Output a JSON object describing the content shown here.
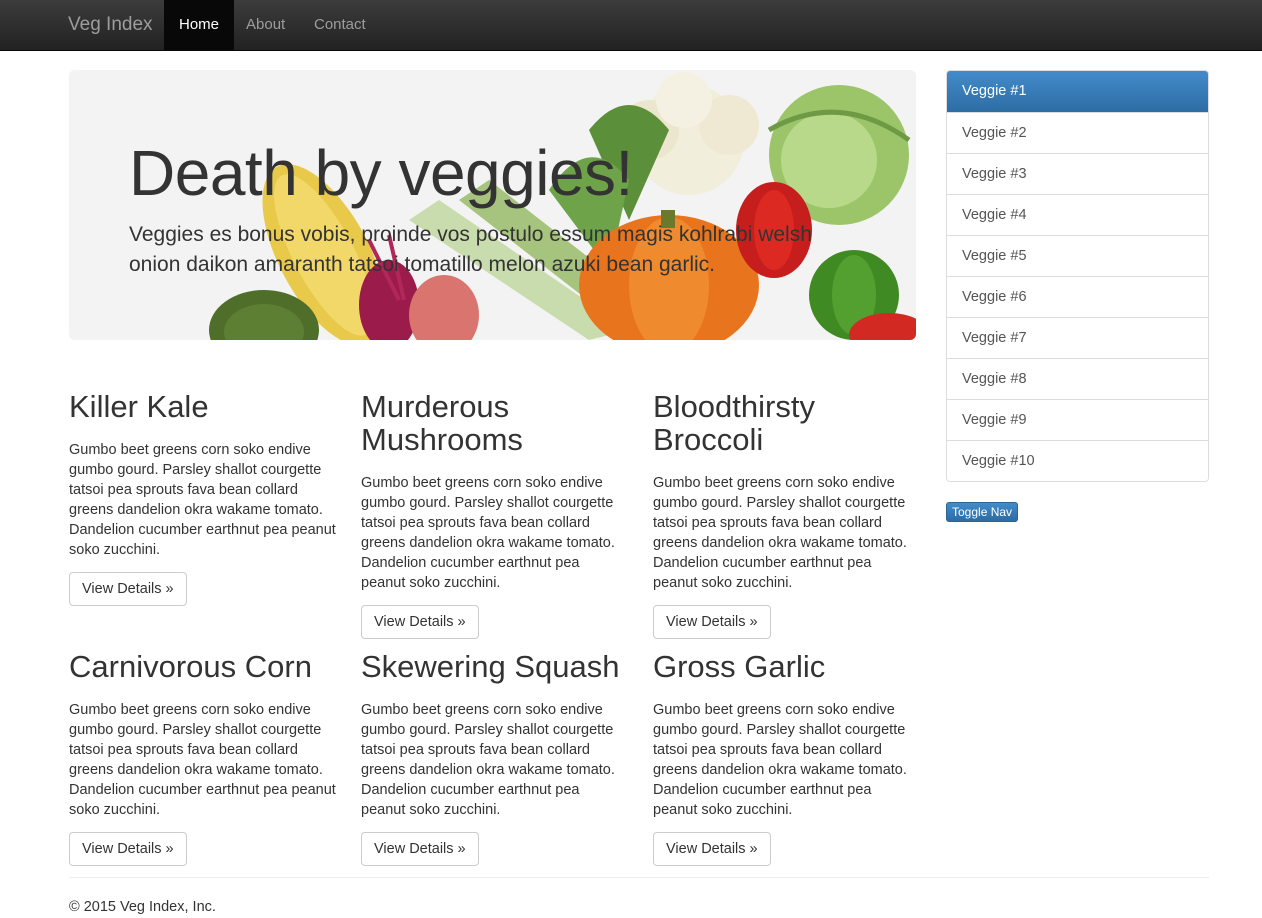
{
  "navbar": {
    "brand": "Veg Index",
    "items": [
      {
        "label": "Home",
        "active": true
      },
      {
        "label": "About",
        "active": false
      },
      {
        "label": "Contact",
        "active": false
      }
    ]
  },
  "jumbotron": {
    "title": "Death by veggies!",
    "text": "Veggies es bonus vobis, proinde vos postulo essum magis kohlrabi welsh onion daikon amaranth tatsoi tomatillo melon azuki bean garlic."
  },
  "cards": [
    {
      "title": "Killer Kale",
      "text": "Gumbo beet greens corn soko endive gumbo gourd. Parsley shallot courgette tatsoi pea sprouts fava bean collard greens dandelion okra wakame tomato. Dandelion cucumber earthnut pea peanut soko zucchini.",
      "button": "View Details »"
    },
    {
      "title": "Murderous Mushrooms",
      "text": "Gumbo beet greens corn soko endive gumbo gourd. Parsley shallot courgette tatsoi pea sprouts fava bean collard greens dandelion okra wakame tomato. Dandelion cucumber earthnut pea peanut soko zucchini.",
      "button": "View Details »"
    },
    {
      "title": "Bloodthirsty Broccoli",
      "text": "Gumbo beet greens corn soko endive gumbo gourd. Parsley shallot courgette tatsoi pea sprouts fava bean collard greens dandelion okra wakame tomato. Dandelion cucumber earthnut pea peanut soko zucchini.",
      "button": "View Details »"
    },
    {
      "title": "Carnivorous Corn",
      "text": "Gumbo beet greens corn soko endive gumbo gourd. Parsley shallot courgette tatsoi pea sprouts fava bean collard greens dandelion okra wakame tomato. Dandelion cucumber earthnut pea peanut soko zucchini.",
      "button": "View Details »"
    },
    {
      "title": "Skewering Squash",
      "text": "Gumbo beet greens corn soko endive gumbo gourd. Parsley shallot courgette tatsoi pea sprouts fava bean collard greens dandelion okra wakame tomato. Dandelion cucumber earthnut pea peanut soko zucchini.",
      "button": "View Details »"
    },
    {
      "title": "Gross Garlic",
      "text": "Gumbo beet greens corn soko endive gumbo gourd. Parsley shallot courgette tatsoi pea sprouts fava bean collard greens dandelion okra wakame tomato. Dandelion cucumber earthnut pea peanut soko zucchini.",
      "button": "View Details »"
    }
  ],
  "sidebar": {
    "items": [
      {
        "label": "Veggie #1",
        "active": true
      },
      {
        "label": "Veggie #2",
        "active": false
      },
      {
        "label": "Veggie #3",
        "active": false
      },
      {
        "label": "Veggie #4",
        "active": false
      },
      {
        "label": "Veggie #5",
        "active": false
      },
      {
        "label": "Veggie #6",
        "active": false
      },
      {
        "label": "Veggie #7",
        "active": false
      },
      {
        "label": "Veggie #8",
        "active": false
      },
      {
        "label": "Veggie #9",
        "active": false
      },
      {
        "label": "Veggie #10",
        "active": false
      }
    ],
    "toggle_label": "Toggle Nav"
  },
  "footer": {
    "text": "© 2015 Veg Index, Inc."
  },
  "colors": {
    "primary": "#337ab7",
    "navbar": "#222222"
  }
}
